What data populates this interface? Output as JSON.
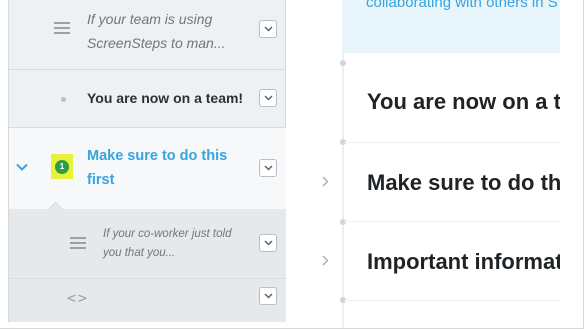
{
  "sidebar": {
    "items": [
      {
        "label": "If your team is using ScreenSteps to man...",
        "icon": "lines-icon"
      },
      {
        "label": "You are now on a team!",
        "icon": "dot-icon"
      },
      {
        "label": "Make sure to do this first",
        "badge": "1",
        "icon": "chevron-down-icon",
        "selected": true
      },
      {
        "label": "If your co-worker just told you that you...",
        "icon": "lines-icon"
      },
      {
        "label": "",
        "icon": "code-icon",
        "glyph": "<>"
      }
    ]
  },
  "main": {
    "banner_text": "collaborating with others in S",
    "headings": [
      "You are now on a team!",
      "Make sure to do this first",
      "Important information"
    ]
  },
  "colors": {
    "accent": "#38a3dd",
    "badge_bg": "#e9f23a",
    "badge_circle": "#2f9d47"
  }
}
